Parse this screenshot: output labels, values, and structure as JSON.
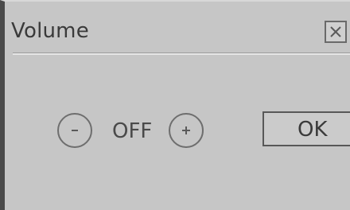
{
  "dialog": {
    "title": "Volume",
    "close_icon": "close-icon",
    "volume_value": "OFF",
    "decrease_icon": "minus-circle-icon",
    "increase_icon": "plus-circle-icon",
    "ok_label": "OK"
  },
  "colors": {
    "background": "#c6c6c6",
    "text": "#3a3a3a",
    "border": "#6e6e6e"
  }
}
